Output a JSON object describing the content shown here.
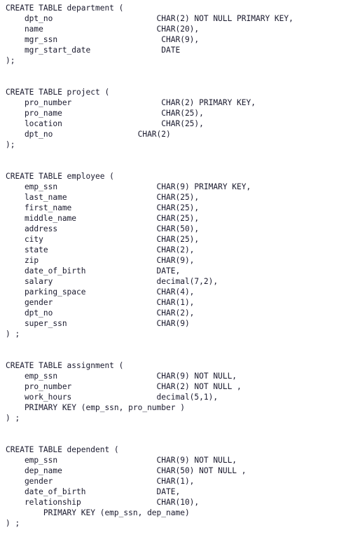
{
  "document": {
    "type": "sql-ddl-script",
    "language": "SQL",
    "statement_count": 5
  },
  "statements": [
    {
      "id": "department",
      "header": "CREATE TABLE department (",
      "lines": [
        "    dpt_no                      CHAR(2) NOT NULL PRIMARY KEY,",
        "    name                        CHAR(20),",
        "    mgr_ssn                      CHAR(9),",
        "    mgr_start_date               DATE"
      ],
      "terminator": ");"
    },
    {
      "id": "project",
      "header": "CREATE TABLE project (",
      "lines": [
        "    pro_number                   CHAR(2) PRIMARY KEY,",
        "    pro_name                     CHAR(25),",
        "    location                     CHAR(25),",
        "    dpt_no                  CHAR(2)"
      ],
      "terminator": ");"
    },
    {
      "id": "employee",
      "header": "CREATE TABLE employee (",
      "lines": [
        "    emp_ssn                     CHAR(9) PRIMARY KEY,",
        "    last_name                   CHAR(25),",
        "    first_name                  CHAR(25),",
        "    middle_name                 CHAR(25),",
        "    address                     CHAR(50),",
        "    city                        CHAR(25),",
        "    state                       CHAR(2),",
        "    zip                         CHAR(9),",
        "    date_of_birth               DATE,",
        "    salary                      decimal(7,2),",
        "    parking_space               CHAR(4),",
        "    gender                      CHAR(1),",
        "    dpt_no                      CHAR(2),",
        "    super_ssn                   CHAR(9)"
      ],
      "terminator": ") ;"
    },
    {
      "id": "assignment",
      "header": "CREATE TABLE assignment (",
      "lines": [
        "    emp_ssn                     CHAR(9) NOT NULL,",
        "    pro_number                  CHAR(2) NOT NULL ,",
        "    work_hours                  decimal(5,1),",
        "    PRIMARY KEY (emp_ssn, pro_number )"
      ],
      "terminator": ") ;"
    },
    {
      "id": "dependent",
      "header": "CREATE TABLE dependent (",
      "lines": [
        "    emp_ssn                     CHAR(9) NOT NULL,",
        "    dep_name                    CHAR(50) NOT NULL ,",
        "    gender                      CHAR(1),",
        "    date_of_birth               DATE,",
        "    relationship                CHAR(10),",
        "        PRIMARY KEY (emp_ssn, dep_name)"
      ],
      "terminator": ") ;"
    }
  ],
  "colors": {
    "background": "#ffffff",
    "text": "#1a1a2e"
  }
}
